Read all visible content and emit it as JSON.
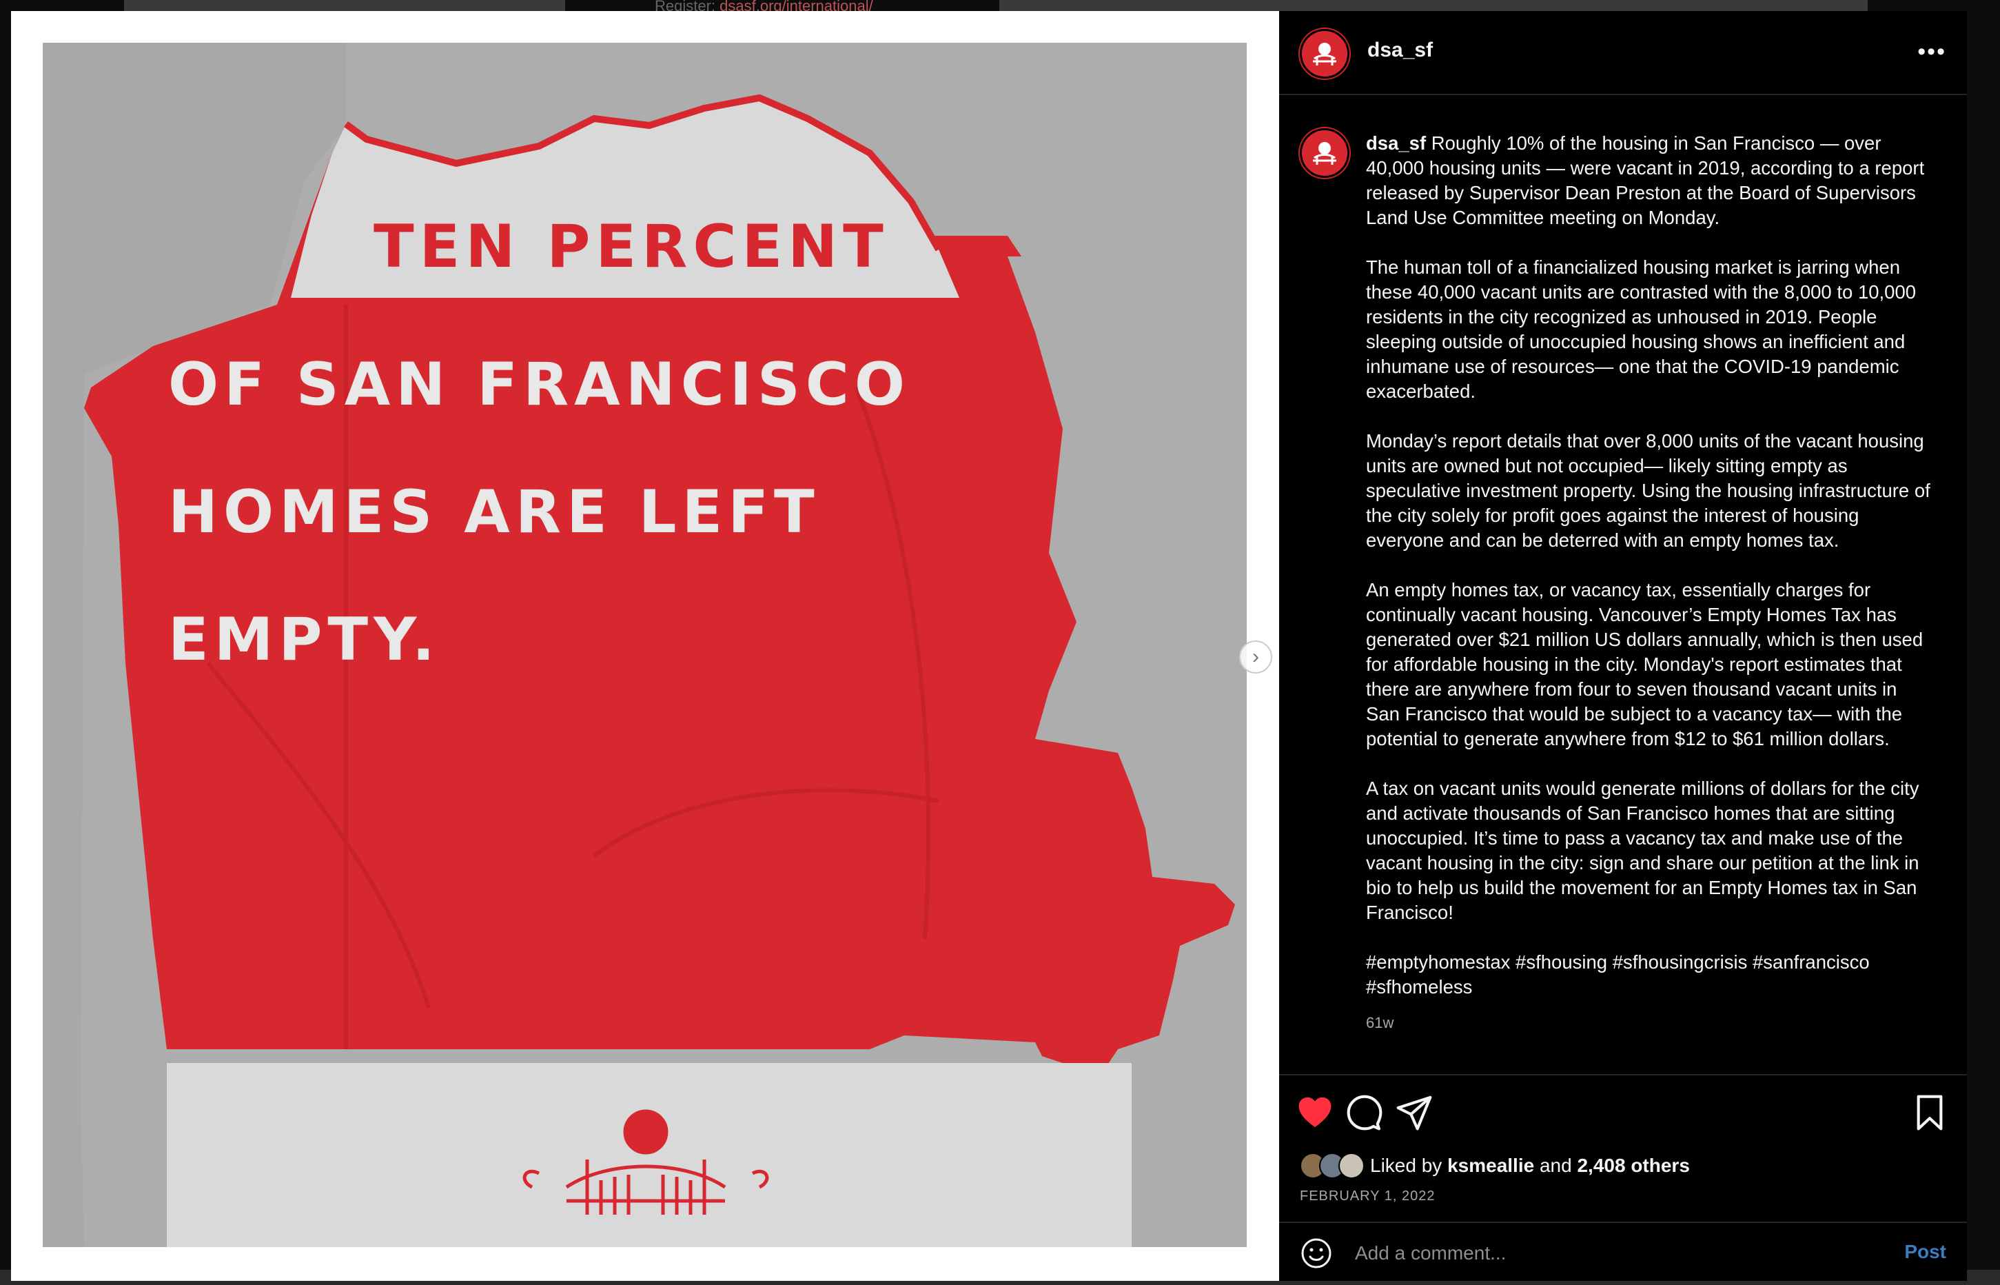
{
  "background": {
    "partial_text_prefix": "Register: ",
    "partial_text_link": "dsasf.org/international/"
  },
  "post": {
    "username": "dsa_sf",
    "image": {
      "headline_lines": [
        "TEN PERCENT",
        "OF SAN FRANCISCO",
        "HOMES ARE LEFT",
        "EMPTY."
      ],
      "map_color": "#d7282f",
      "map_bg_color": "#a8a8a8"
    },
    "caption": {
      "username": "dsa_sf",
      "paragraphs": [
        "Roughly 10% of the housing in San Francisco — over 40,000 housing units — were vacant in 2019, according to a report released by Supervisor Dean Preston at the Board of Supervisors Land Use Committee meeting on Monday.",
        "The human toll of a financialized housing market is jarring when these 40,000 vacant units are contrasted with the 8,000 to 10,000 residents in the city recognized as unhoused in 2019. People sleeping outside of unoccupied housing shows an inefficient and inhumane use of resources— one that the COVID-19 pandemic exacerbated.",
        "Monday’s report details that over 8,000 units of the vacant housing units are owned but not occupied— likely sitting empty as speculative investment property. Using the housing infrastructure of the city solely for profit goes against the interest of housing everyone and can be deterred with an empty homes tax.",
        "An empty homes tax, or vacancy tax, essentially charges for continually vacant housing. Vancouver’s Empty Homes Tax has generated over $21 million US dollars annually, which is then used for affordable housing in the city. Monday's report estimates that there are anywhere from four to seven thousand vacant units in San Francisco that would be subject to a vacancy tax— with the potential to generate anywhere from $12 to $61 million dollars.",
        "A tax on vacant units would generate millions of dollars for the city and activate thousands of San Francisco homes that are sitting unoccupied. It’s time to pass a vacancy tax and make use of the vacant housing in the city: sign and share our petition at the link in bio to help us build the movement for an Empty Homes tax in San Francisco!",
        "#emptyhomestax #sfhousing #sfhousingcrisis #sanfrancisco #sfhomeless"
      ],
      "age": "61w"
    },
    "likes": {
      "prefix": "Liked by",
      "first_liker": "ksmeallie",
      "conjunction": "and",
      "others": "2,408 others"
    },
    "date": "FEBRUARY 1, 2022",
    "liked": true,
    "like_color": "#ff3040"
  },
  "comment": {
    "placeholder": "Add a comment...",
    "post_label": "Post"
  },
  "icons": {
    "more": "more-options-icon",
    "like": "heart-icon",
    "comment": "comment-icon",
    "share": "paper-plane-icon",
    "save": "bookmark-icon",
    "emoji": "smiley-icon",
    "next": "chevron-right-icon"
  }
}
